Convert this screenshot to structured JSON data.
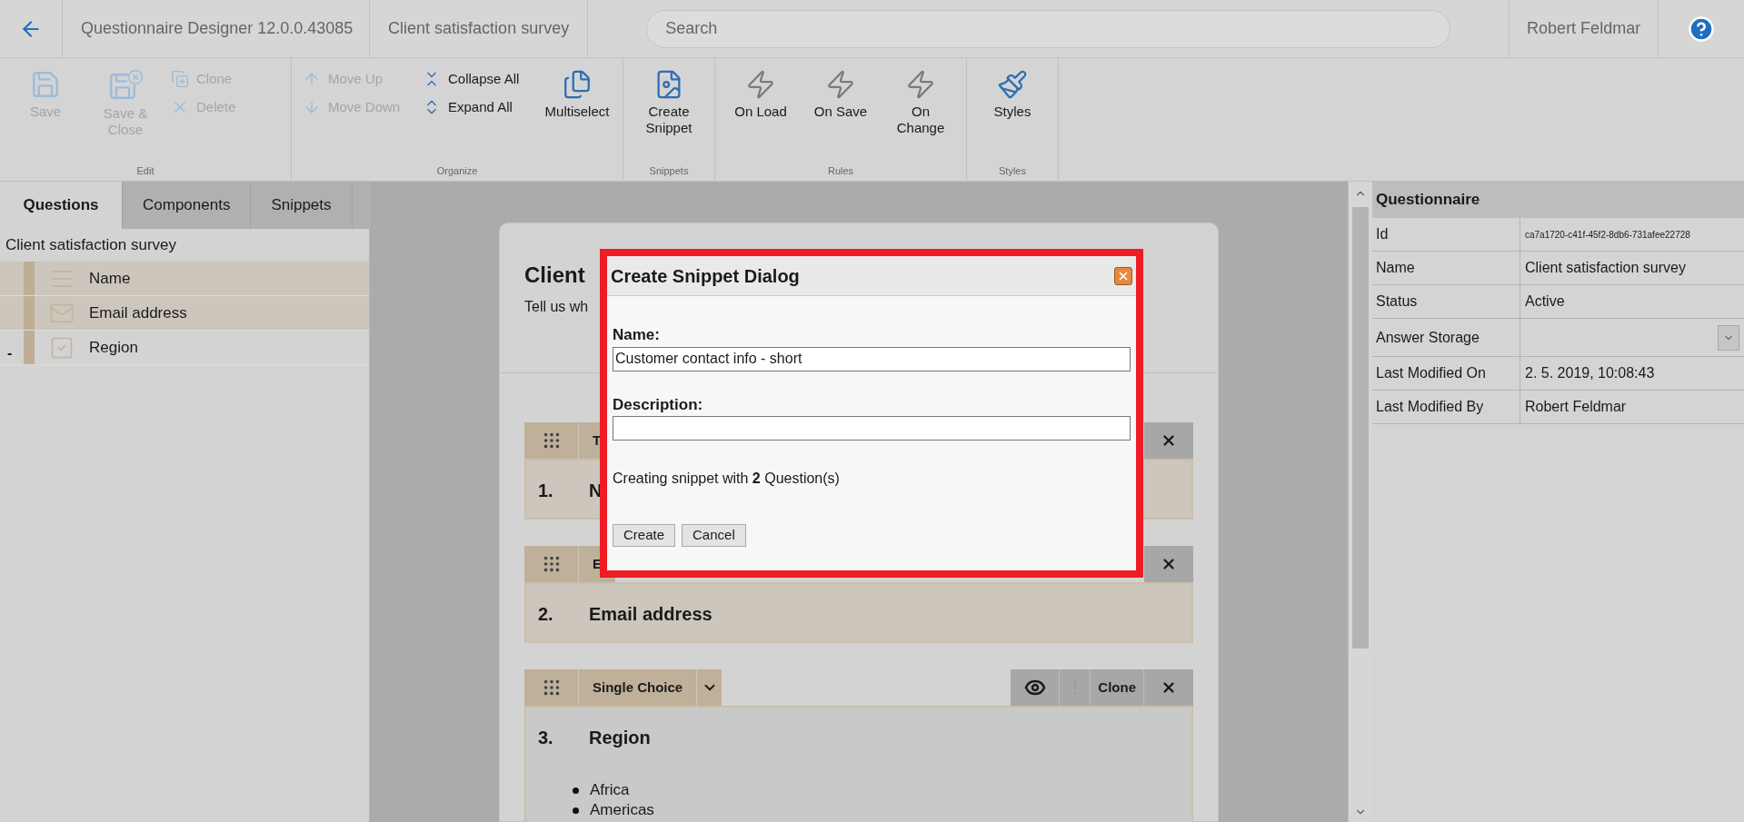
{
  "header": {
    "app_title": "Questionnaire Designer 12.0.0.43085",
    "document_title": "Client satisfaction survey",
    "search": {
      "placeholder": "Search"
    },
    "user": "Robert Feldmar"
  },
  "ribbon": [
    {
      "label": "Edit",
      "columns": [
        {
          "kind": "large",
          "buttons": [
            {
              "kind": "save",
              "label": "Save",
              "disabled": true
            }
          ]
        },
        {
          "kind": "large",
          "buttons": [
            {
              "kind": "save-close",
              "label": "Save & Close",
              "disabled": true
            }
          ]
        },
        {
          "kind": "small",
          "buttons": [
            {
              "kind": "clone",
              "label": "Clone",
              "disabled": true
            },
            {
              "kind": "delete",
              "label": "Delete",
              "disabled": true
            }
          ]
        }
      ]
    },
    {
      "label": "Organize",
      "columns": [
        {
          "kind": "small",
          "buttons": [
            {
              "kind": "move-up",
              "label": "Move Up",
              "disabled": true
            },
            {
              "kind": "move-down",
              "label": "Move Down",
              "disabled": true
            }
          ]
        },
        {
          "kind": "small",
          "buttons": [
            {
              "kind": "collapse",
              "label": "Collapse All",
              "disabled": false
            },
            {
              "kind": "expand",
              "label": "Expand All",
              "disabled": false
            }
          ]
        },
        {
          "kind": "large",
          "buttons": [
            {
              "kind": "multiselect",
              "label": "Multiselect",
              "disabled": false
            }
          ]
        }
      ]
    },
    {
      "label": "Snippets",
      "columns": [
        {
          "kind": "large",
          "buttons": [
            {
              "kind": "snippet",
              "label": "Create Snippet",
              "disabled": false
            }
          ]
        }
      ]
    },
    {
      "label": "Rules",
      "columns": [
        {
          "kind": "large",
          "buttons": [
            {
              "kind": "rule",
              "label": "On Load",
              "disabled": false
            }
          ]
        },
        {
          "kind": "large",
          "buttons": [
            {
              "kind": "rule",
              "label": "On Save",
              "disabled": false
            }
          ]
        },
        {
          "kind": "large",
          "buttons": [
            {
              "kind": "rule",
              "label": "On Change",
              "disabled": false
            }
          ]
        }
      ]
    },
    {
      "label": "Styles",
      "columns": [
        {
          "kind": "large",
          "buttons": [
            {
              "kind": "styles",
              "label": "Styles",
              "disabled": false
            }
          ]
        }
      ]
    }
  ],
  "left_tabs": [
    {
      "label": "Questions",
      "selected": true
    },
    {
      "label": "Components",
      "selected": false
    },
    {
      "label": "Snippets",
      "selected": false
    }
  ],
  "tree": {
    "label": "Client satisfaction survey",
    "children": [
      {
        "kind": "text",
        "label": "Name",
        "selected": true
      },
      {
        "kind": "email",
        "label": "Email address",
        "selected": true
      },
      {
        "kind": "choice",
        "label": "Region",
        "selected": false,
        "marker": "-"
      }
    ]
  },
  "survey": {
    "title": "Client",
    "description": "Tell us wh",
    "questions": [
      {
        "type": "T",
        "number": "1.",
        "title": "N",
        "selected": true
      },
      {
        "type": "E",
        "number": "2.",
        "title": "Email address",
        "selected": true
      },
      {
        "type": "Single Choice",
        "number": "3.",
        "title": "Region",
        "selected": false,
        "clone": "Clone",
        "options": [
          "Africa",
          "Americas"
        ]
      }
    ]
  },
  "dialog": {
    "title": "Create Snippet Dialog",
    "name_label": "Name:",
    "name_value": "Customer contact info - short",
    "description_label": "Description:",
    "summary": "Creating snippet with **2** Question(s)",
    "buttons": [
      "Create",
      "Cancel"
    ]
  },
  "properties": {
    "title": "Questionnaire",
    "rows": [
      {
        "kind": "small",
        "label": "Id",
        "value": "ca7a1720-c41f-45f2-8db6-731afee22728"
      },
      {
        "kind": "text",
        "label": "Name",
        "value": "Client satisfaction survey"
      },
      {
        "kind": "text",
        "label": "Status",
        "value": "Active"
      },
      {
        "kind": "select",
        "label": "Answer Storage"
      },
      {
        "kind": "text",
        "label": "Last Modified On",
        "value": "2. 5. 2019, 10:08:43"
      },
      {
        "kind": "text",
        "label": "Last Modified By",
        "value": "Robert Feldmar"
      }
    ]
  }
}
